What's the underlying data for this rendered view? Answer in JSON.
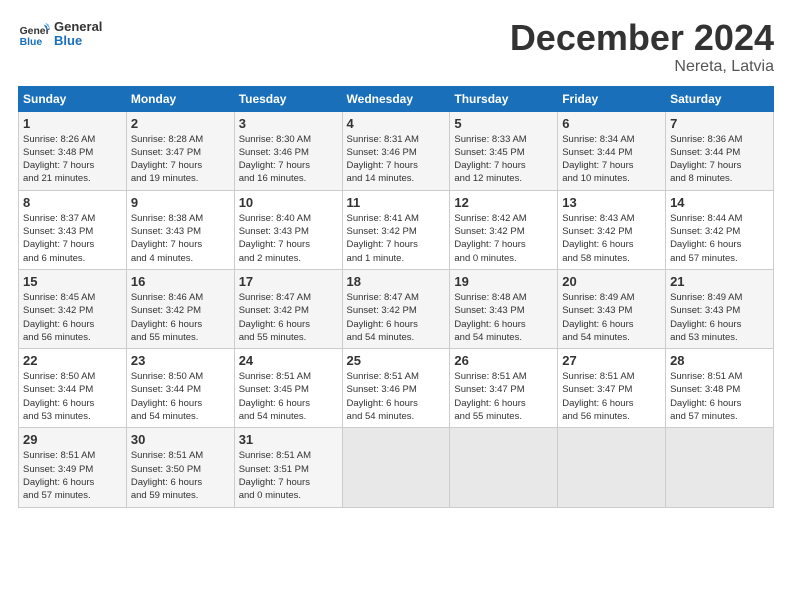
{
  "header": {
    "logo_general": "General",
    "logo_blue": "Blue",
    "main_title": "December 2024",
    "subtitle": "Nereta, Latvia"
  },
  "days_of_week": [
    "Sunday",
    "Monday",
    "Tuesday",
    "Wednesday",
    "Thursday",
    "Friday",
    "Saturday"
  ],
  "weeks": [
    [
      {
        "day": "1",
        "sunrise": "8:26 AM",
        "sunset": "3:48 PM",
        "daylight": "7 hours and 21 minutes."
      },
      {
        "day": "2",
        "sunrise": "8:28 AM",
        "sunset": "3:47 PM",
        "daylight": "7 hours and 19 minutes."
      },
      {
        "day": "3",
        "sunrise": "8:30 AM",
        "sunset": "3:46 PM",
        "daylight": "7 hours and 16 minutes."
      },
      {
        "day": "4",
        "sunrise": "8:31 AM",
        "sunset": "3:46 PM",
        "daylight": "7 hours and 14 minutes."
      },
      {
        "day": "5",
        "sunrise": "8:33 AM",
        "sunset": "3:45 PM",
        "daylight": "7 hours and 12 minutes."
      },
      {
        "day": "6",
        "sunrise": "8:34 AM",
        "sunset": "3:44 PM",
        "daylight": "7 hours and 10 minutes."
      },
      {
        "day": "7",
        "sunrise": "8:36 AM",
        "sunset": "3:44 PM",
        "daylight": "7 hours and 8 minutes."
      }
    ],
    [
      {
        "day": "8",
        "sunrise": "8:37 AM",
        "sunset": "3:43 PM",
        "daylight": "7 hours and 6 minutes."
      },
      {
        "day": "9",
        "sunrise": "8:38 AM",
        "sunset": "3:43 PM",
        "daylight": "7 hours and 4 minutes."
      },
      {
        "day": "10",
        "sunrise": "8:40 AM",
        "sunset": "3:43 PM",
        "daylight": "7 hours and 2 minutes."
      },
      {
        "day": "11",
        "sunrise": "8:41 AM",
        "sunset": "3:42 PM",
        "daylight": "7 hours and 1 minute."
      },
      {
        "day": "12",
        "sunrise": "8:42 AM",
        "sunset": "3:42 PM",
        "daylight": "7 hours and 0 minutes."
      },
      {
        "day": "13",
        "sunrise": "8:43 AM",
        "sunset": "3:42 PM",
        "daylight": "6 hours and 58 minutes."
      },
      {
        "day": "14",
        "sunrise": "8:44 AM",
        "sunset": "3:42 PM",
        "daylight": "6 hours and 57 minutes."
      }
    ],
    [
      {
        "day": "15",
        "sunrise": "8:45 AM",
        "sunset": "3:42 PM",
        "daylight": "6 hours and 56 minutes."
      },
      {
        "day": "16",
        "sunrise": "8:46 AM",
        "sunset": "3:42 PM",
        "daylight": "6 hours and 55 minutes."
      },
      {
        "day": "17",
        "sunrise": "8:47 AM",
        "sunset": "3:42 PM",
        "daylight": "6 hours and 55 minutes."
      },
      {
        "day": "18",
        "sunrise": "8:47 AM",
        "sunset": "3:42 PM",
        "daylight": "6 hours and 54 minutes."
      },
      {
        "day": "19",
        "sunrise": "8:48 AM",
        "sunset": "3:43 PM",
        "daylight": "6 hours and 54 minutes."
      },
      {
        "day": "20",
        "sunrise": "8:49 AM",
        "sunset": "3:43 PM",
        "daylight": "6 hours and 54 minutes."
      },
      {
        "day": "21",
        "sunrise": "8:49 AM",
        "sunset": "3:43 PM",
        "daylight": "6 hours and 53 minutes."
      }
    ],
    [
      {
        "day": "22",
        "sunrise": "8:50 AM",
        "sunset": "3:44 PM",
        "daylight": "6 hours and 53 minutes."
      },
      {
        "day": "23",
        "sunrise": "8:50 AM",
        "sunset": "3:44 PM",
        "daylight": "6 hours and 54 minutes."
      },
      {
        "day": "24",
        "sunrise": "8:51 AM",
        "sunset": "3:45 PM",
        "daylight": "6 hours and 54 minutes."
      },
      {
        "day": "25",
        "sunrise": "8:51 AM",
        "sunset": "3:46 PM",
        "daylight": "6 hours and 54 minutes."
      },
      {
        "day": "26",
        "sunrise": "8:51 AM",
        "sunset": "3:47 PM",
        "daylight": "6 hours and 55 minutes."
      },
      {
        "day": "27",
        "sunrise": "8:51 AM",
        "sunset": "3:47 PM",
        "daylight": "6 hours and 56 minutes."
      },
      {
        "day": "28",
        "sunrise": "8:51 AM",
        "sunset": "3:48 PM",
        "daylight": "6 hours and 57 minutes."
      }
    ],
    [
      {
        "day": "29",
        "sunrise": "8:51 AM",
        "sunset": "3:49 PM",
        "daylight": "6 hours and 57 minutes."
      },
      {
        "day": "30",
        "sunrise": "8:51 AM",
        "sunset": "3:50 PM",
        "daylight": "6 hours and 59 minutes."
      },
      {
        "day": "31",
        "sunrise": "8:51 AM",
        "sunset": "3:51 PM",
        "daylight": "7 hours and 0 minutes."
      },
      null,
      null,
      null,
      null
    ]
  ]
}
